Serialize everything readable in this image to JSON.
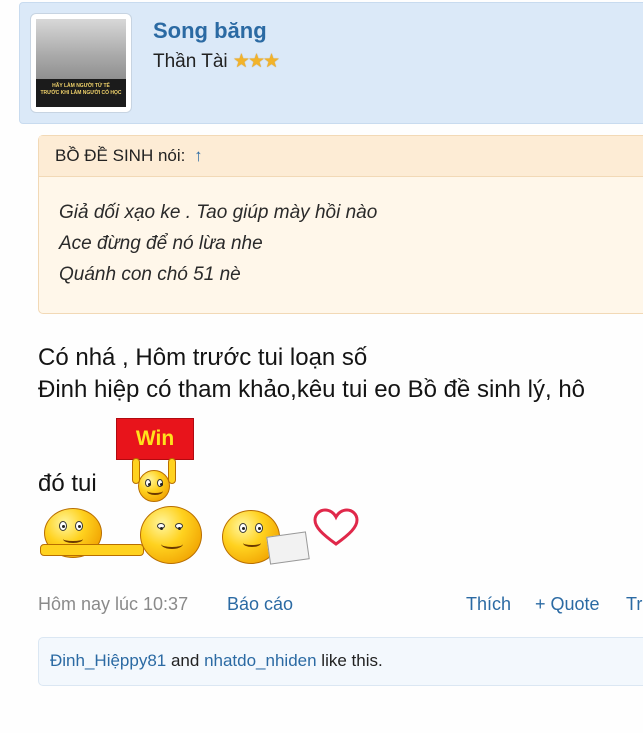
{
  "author": {
    "name": "Song băng",
    "title": "Thần Tài",
    "stars": "★★★",
    "avatar_caption_line1": "HÃY LÀM NGƯỜI TỬ TẾ",
    "avatar_caption_line2": "TRƯỚC KHI LÀM NGƯỜI CÓ HỌC"
  },
  "quote": {
    "author_prefix": "BỒ ĐỀ SINH nói:",
    "jump_icon": "↑",
    "lines": [
      "Giả dối xạo ke . Tao giúp mày hồi nào",
      "Ace đừng để nó lừa nhe",
      "Quánh con chó 51 nè"
    ]
  },
  "message": {
    "lines": [
      "Có nhá , Hôm trước tui loạn số",
      "Đinh hiệp có tham khảo,kêu tui eo Bồ đề sinh lý, hô",
      "đó tui"
    ],
    "sign_text": "Win"
  },
  "meta": {
    "time": "Hôm nay lúc 10:37",
    "report": "Báo cáo",
    "like": "Thích",
    "quote": "+ Quote",
    "reply_cut": "Tr"
  },
  "likes": {
    "user1": "Đinh_Hiệppy81",
    "and": " and ",
    "user2": "nhatdo_nhiden",
    "suffix": " like this."
  },
  "colors": {
    "link": "#2b6aa3",
    "author_bg": "#dbe9f8",
    "quote_bg": "#fff7ea"
  }
}
